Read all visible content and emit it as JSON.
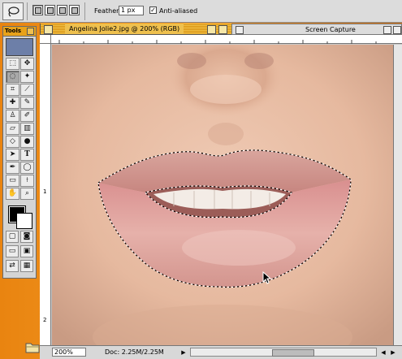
{
  "options_bar": {
    "feather_label": "Feather:",
    "feather_value": "1 px",
    "antialiased_label": "Anti-aliased",
    "antialiased_checked": true
  },
  "tools_palette": {
    "title": "Tools",
    "tools": [
      "marquee",
      "move",
      "lasso",
      "magic-wand",
      "crop",
      "slice",
      "healing",
      "brush",
      "stamp",
      "history-brush",
      "eraser",
      "gradient",
      "blur",
      "dodge",
      "path-select",
      "type",
      "pen",
      "shape",
      "notes",
      "eyedropper",
      "hand",
      "zoom"
    ],
    "foreground_color": "#000000",
    "background_color": "#ffffff"
  },
  "document": {
    "title": "Angelina Jolie2.jpg @ 200% (RGB)",
    "zoom": "200%",
    "doc_info": "Doc: 2.25M/2.25M",
    "ruler_marks": [
      "1",
      "2"
    ]
  },
  "capture_window": {
    "title": "Screen Capture"
  },
  "colors": {
    "title_bar": "#e0a020",
    "desktop": "#e98410",
    "skin": "#e8bfa8",
    "lips": "#d6948f"
  }
}
